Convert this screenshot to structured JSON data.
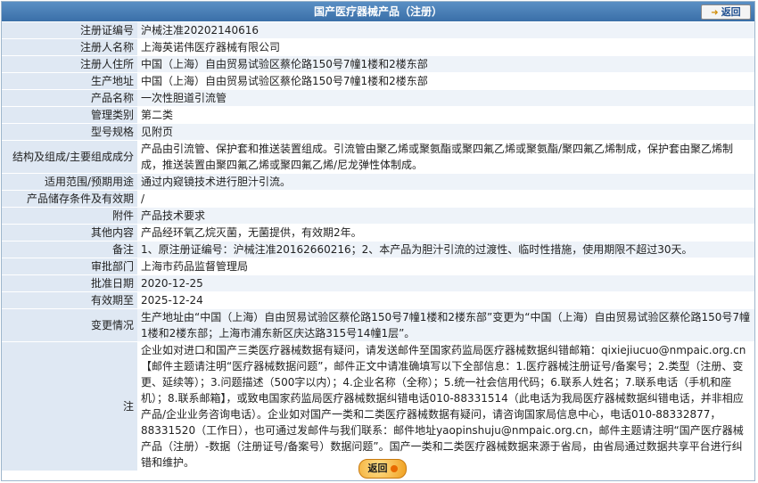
{
  "header": {
    "title": "国产医疗器械产品（注册）",
    "back_label": "返回"
  },
  "rows": [
    {
      "label": "注册证编号",
      "value": "沪械注准20202140616"
    },
    {
      "label": "注册人名称",
      "value": "上海英诺伟医疗器械有限公司"
    },
    {
      "label": "注册人住所",
      "value": "中国（上海）自由贸易试验区蔡伦路150号7幢1楼和2楼东部"
    },
    {
      "label": "生产地址",
      "value": "中国（上海）自由贸易试验区蔡伦路150号7幢1楼和2楼东部"
    },
    {
      "label": "产品名称",
      "value": "一次性胆道引流管"
    },
    {
      "label": "管理类别",
      "value": "第二类"
    },
    {
      "label": "型号规格",
      "value": "见附页"
    },
    {
      "label": "结构及组成/主要组成成分",
      "value": "产品由引流管、保护套和推送装置组成。引流管由聚乙烯或聚氨酯或聚四氟乙烯或聚氨酯/聚四氟乙烯制成，保护套由聚乙烯制成，推送装置由聚四氟乙烯或聚四氟乙烯/尼龙弹性体制成。"
    },
    {
      "label": "适用范围/预期用途",
      "value": "通过内窥镜技术进行胆汁引流。"
    },
    {
      "label": "产品储存条件及有效期",
      "value": "/"
    },
    {
      "label": "附件",
      "value": "产品技术要求"
    },
    {
      "label": "其他内容",
      "value": "产品经环氧乙烷灭菌，无菌提供，有效期2年。"
    },
    {
      "label": "备注",
      "value": "1、原注册证编号：沪械注准20162660216；2、本产品为胆汁引流的过渡性、临时性措施，使用期限不超过30天。"
    },
    {
      "label": "审批部门",
      "value": "上海市药品监督管理局"
    },
    {
      "label": "批准日期",
      "value": "2020-12-25"
    },
    {
      "label": "有效期至",
      "value": "2025-12-24"
    },
    {
      "label": "变更情况",
      "value": "生产地址由“中国（上海）自由贸易试验区蔡伦路150号7幢1楼和2楼东部”变更为“中国（上海）自由贸易试验区蔡伦路150号7幢1楼和2楼东部；上海市浦东新区庆达路315号14幢1层”。"
    },
    {
      "label": "注",
      "value": "企业如对进口和国产三类医疗器械数据有疑问，请发送邮件至国家药监局医疗器械数据纠错邮箱：qixiejiucuo@nmpaic.org.cn【邮件主题请注明“医疗器械数据问题”，邮件正文中请准确填写以下全部信息：1.医疗器械注册证号/备案号；2.类型（注册、变更、延续等）；3.问题描述（500字以内）；4.企业名称（全称）；5.统一社会信用代码；6.联系人姓名；7.联系电话（手机和座机）；8.联系邮箱】，或致电国家药监局医疗器械数据纠错电话010-88331514（此电话为我局医疗器械数据纠错电话，并非相应产品/企业业务咨询电话）。企业如对国产一类和二类医疗器械数据有疑问，请咨询国家局信息中心，电话010-88332877，88331520（工作日），也可通过发邮件与我们联系：邮件地址yaopinshuju@nmpaic.org.cn，邮件主题请注明“国产医疗器械产品（注册）-数据（注册证号/备案号）数据问题”。国产一类和二类医疗器械数据来源于省局，由省局通过数据共享平台进行纠错和维护。"
    }
  ],
  "footer": {
    "back_label": "返回"
  }
}
